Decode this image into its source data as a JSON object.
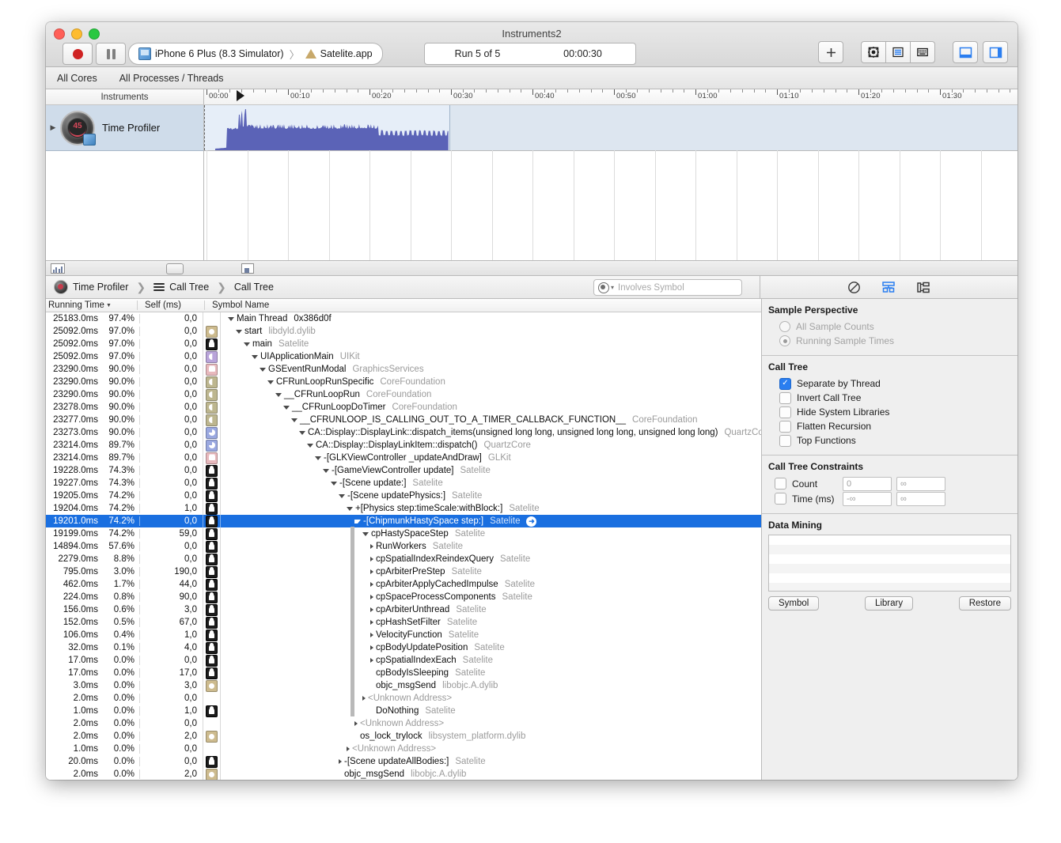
{
  "window": {
    "title": "Instruments2"
  },
  "toolbar": {
    "record_label": "record-button",
    "pause_label": "pause-button",
    "target_device": "iPhone 6 Plus (8.3 Simulator)",
    "target_separator": "〉",
    "target_app": "Satelite.app",
    "run_label": "Run 5 of 5",
    "run_time": "00:00:30",
    "add_button": "+",
    "buttons": [
      "add-instrument",
      "settings",
      "list-view",
      "keyboard-view",
      "library-panel",
      "inspector-panel"
    ]
  },
  "filterbar": {
    "cores": "All Cores",
    "processes": "All Processes / Threads"
  },
  "timeline": {
    "header_label": "Instruments",
    "ticks": [
      "00:00",
      "00:10",
      "00:20",
      "00:30",
      "00:40",
      "00:50",
      "01:00",
      "01:10",
      "01:20",
      "01:30"
    ],
    "instrument_name": "Time Profiler",
    "instrument_icon_number": "45",
    "graph_color": "#5b63b7",
    "selection_color": "#e6eef8"
  },
  "detail_header": {
    "instrument": "Time Profiler",
    "view_mode": "Call Tree",
    "breadcrumb": "Call Tree",
    "search_placeholder": "Involves Symbol"
  },
  "columns": {
    "running_time": "Running Time",
    "self_ms": "Self (ms)",
    "symbol_name": "Symbol Name"
  },
  "rows": [
    {
      "time": "25183.0ms",
      "pct": "97.4%",
      "self": "0,0",
      "icon": "none",
      "depth": 0,
      "tri": "open",
      "name": "Main Thread",
      "lib": "0x386d0f",
      "libstyle": "plain"
    },
    {
      "time": "25092.0ms",
      "pct": "97.0%",
      "self": "0,0",
      "icon": "gear",
      "depth": 1,
      "tri": "open",
      "name": "start",
      "lib": "libdyld.dylib"
    },
    {
      "time": "25092.0ms",
      "pct": "97.0%",
      "self": "0,0",
      "icon": "user",
      "depth": 2,
      "tri": "open",
      "name": "main",
      "lib": "Satelite"
    },
    {
      "time": "25092.0ms",
      "pct": "97.0%",
      "self": "0,0",
      "icon": "purple",
      "depth": 3,
      "tri": "open",
      "name": "UIApplicationMain",
      "lib": "UIKit"
    },
    {
      "time": "23290.0ms",
      "pct": "90.0%",
      "self": "0,0",
      "icon": "pink",
      "depth": 4,
      "tri": "open",
      "name": "GSEventRunModal",
      "lib": "GraphicsServices"
    },
    {
      "time": "23290.0ms",
      "pct": "90.0%",
      "self": "0,0",
      "icon": "olive",
      "depth": 5,
      "tri": "open",
      "name": "CFRunLoopRunSpecific",
      "lib": "CoreFoundation"
    },
    {
      "time": "23290.0ms",
      "pct": "90.0%",
      "self": "0,0",
      "icon": "olive",
      "depth": 6,
      "tri": "open",
      "name": "__CFRunLoopRun",
      "lib": "CoreFoundation"
    },
    {
      "time": "23278.0ms",
      "pct": "90.0%",
      "self": "0,0",
      "icon": "olive",
      "depth": 7,
      "tri": "open",
      "name": "__CFRunLoopDoTimer",
      "lib": "CoreFoundation"
    },
    {
      "time": "23277.0ms",
      "pct": "90.0%",
      "self": "0,0",
      "icon": "olive",
      "depth": 8,
      "tri": "open",
      "name": "__CFRUNLOOP_IS_CALLING_OUT_TO_A_TIMER_CALLBACK_FUNCTION__",
      "lib": "CoreFoundation"
    },
    {
      "time": "23273.0ms",
      "pct": "90.0%",
      "self": "0,0",
      "icon": "blue",
      "depth": 9,
      "tri": "open",
      "name": "CA::Display::DisplayLink::dispatch_items(unsigned long long, unsigned long long, unsigned long long)",
      "lib": "QuartzCore"
    },
    {
      "time": "23214.0ms",
      "pct": "89.7%",
      "self": "0,0",
      "icon": "blue",
      "depth": 10,
      "tri": "open",
      "name": "CA::Display::DisplayLinkItem::dispatch()",
      "lib": "QuartzCore"
    },
    {
      "time": "23214.0ms",
      "pct": "89.7%",
      "self": "0,0",
      "icon": "pink",
      "depth": 11,
      "tri": "open",
      "name": "-[GLKViewController _updateAndDraw]",
      "lib": "GLKit"
    },
    {
      "time": "19228.0ms",
      "pct": "74.3%",
      "self": "0,0",
      "icon": "user",
      "depth": 12,
      "tri": "open",
      "name": "-[GameViewController update]",
      "lib": "Satelite"
    },
    {
      "time": "19227.0ms",
      "pct": "74.3%",
      "self": "0,0",
      "icon": "user",
      "depth": 13,
      "tri": "open",
      "name": "-[Scene update:]",
      "lib": "Satelite"
    },
    {
      "time": "19205.0ms",
      "pct": "74.2%",
      "self": "0,0",
      "icon": "user",
      "depth": 14,
      "tri": "open",
      "name": "-[Scene updatePhysics:]",
      "lib": "Satelite"
    },
    {
      "time": "19204.0ms",
      "pct": "74.2%",
      "self": "1,0",
      "icon": "user",
      "depth": 15,
      "tri": "open",
      "name": "+[Physics step:timeScale:withBlock:]",
      "lib": "Satelite"
    },
    {
      "time": "19201.0ms",
      "pct": "74.2%",
      "self": "0,0",
      "icon": "user",
      "depth": 16,
      "tri": "open",
      "name": "-[ChipmunkHastySpace step:]",
      "lib": "Satelite",
      "selected": true,
      "arrow": true
    },
    {
      "time": "19199.0ms",
      "pct": "74.2%",
      "self": "59,0",
      "icon": "user",
      "depth": 17,
      "tri": "open",
      "name": "cpHastySpaceStep",
      "lib": "Satelite"
    },
    {
      "time": "14894.0ms",
      "pct": "57.6%",
      "self": "0,0",
      "icon": "user",
      "depth": 18,
      "tri": "closed",
      "name": "RunWorkers",
      "lib": "Satelite"
    },
    {
      "time": "2279.0ms",
      "pct": "8.8%",
      "self": "0,0",
      "icon": "user",
      "depth": 18,
      "tri": "closed",
      "name": "cpSpatialIndexReindexQuery",
      "lib": "Satelite"
    },
    {
      "time": "795.0ms",
      "pct": "3.0%",
      "self": "190,0",
      "icon": "user",
      "depth": 18,
      "tri": "closed",
      "name": "cpArbiterPreStep",
      "lib": "Satelite"
    },
    {
      "time": "462.0ms",
      "pct": "1.7%",
      "self": "44,0",
      "icon": "user",
      "depth": 18,
      "tri": "closed",
      "name": "cpArbiterApplyCachedImpulse",
      "lib": "Satelite"
    },
    {
      "time": "224.0ms",
      "pct": "0.8%",
      "self": "90,0",
      "icon": "user",
      "depth": 18,
      "tri": "closed",
      "name": "cpSpaceProcessComponents",
      "lib": "Satelite"
    },
    {
      "time": "156.0ms",
      "pct": "0.6%",
      "self": "3,0",
      "icon": "user",
      "depth": 18,
      "tri": "closed",
      "name": "cpArbiterUnthread",
      "lib": "Satelite"
    },
    {
      "time": "152.0ms",
      "pct": "0.5%",
      "self": "67,0",
      "icon": "user",
      "depth": 18,
      "tri": "closed",
      "name": "cpHashSetFilter",
      "lib": "Satelite"
    },
    {
      "time": "106.0ms",
      "pct": "0.4%",
      "self": "1,0",
      "icon": "user",
      "depth": 18,
      "tri": "closed",
      "name": "VelocityFunction",
      "lib": "Satelite"
    },
    {
      "time": "32.0ms",
      "pct": "0.1%",
      "self": "4,0",
      "icon": "user",
      "depth": 18,
      "tri": "closed",
      "name": "cpBodyUpdatePosition",
      "lib": "Satelite"
    },
    {
      "time": "17.0ms",
      "pct": "0.0%",
      "self": "0,0",
      "icon": "user",
      "depth": 18,
      "tri": "closed",
      "name": "cpSpatialIndexEach",
      "lib": "Satelite"
    },
    {
      "time": "17.0ms",
      "pct": "0.0%",
      "self": "17,0",
      "icon": "user",
      "depth": 18,
      "tri": "none",
      "name": "cpBodyIsSleeping",
      "lib": "Satelite"
    },
    {
      "time": "3.0ms",
      "pct": "0.0%",
      "self": "3,0",
      "icon": "gear",
      "depth": 18,
      "tri": "none",
      "name": "objc_msgSend",
      "lib": "libobjc.A.dylib"
    },
    {
      "time": "2.0ms",
      "pct": "0.0%",
      "self": "0,0",
      "icon": "none",
      "depth": 17,
      "tri": "closed",
      "name": "<Unknown Address>",
      "lib": "",
      "libstyle": "dim"
    },
    {
      "time": "1.0ms",
      "pct": "0.0%",
      "self": "1,0",
      "icon": "user",
      "depth": 18,
      "tri": "none",
      "name": "DoNothing",
      "lib": "Satelite"
    },
    {
      "time": "2.0ms",
      "pct": "0.0%",
      "self": "0,0",
      "icon": "none",
      "depth": 16,
      "tri": "closed",
      "name": "<Unknown Address>",
      "lib": "",
      "libstyle": "dim"
    },
    {
      "time": "2.0ms",
      "pct": "0.0%",
      "self": "2,0",
      "icon": "gear",
      "depth": 16,
      "tri": "none",
      "name": "os_lock_trylock",
      "lib": "libsystem_platform.dylib"
    },
    {
      "time": "1.0ms",
      "pct": "0.0%",
      "self": "0,0",
      "icon": "none",
      "depth": 15,
      "tri": "closed",
      "name": "<Unknown Address>",
      "lib": "",
      "libstyle": "dim"
    },
    {
      "time": "20.0ms",
      "pct": "0.0%",
      "self": "0,0",
      "icon": "user",
      "depth": 14,
      "tri": "closed",
      "name": "-[Scene updateAllBodies:]",
      "lib": "Satelite"
    },
    {
      "time": "2.0ms",
      "pct": "0.0%",
      "self": "2,0",
      "icon": "gear",
      "depth": 14,
      "tri": "none",
      "name": "objc_msgSend",
      "lib": "libobjc.A.dylib"
    }
  ],
  "inspector": {
    "sample_perspective": {
      "title": "Sample Perspective",
      "options": [
        {
          "label": "All Sample Counts",
          "selected": false
        },
        {
          "label": "Running Sample Times",
          "selected": true
        }
      ]
    },
    "call_tree": {
      "title": "Call Tree",
      "options": [
        {
          "label": "Separate by Thread",
          "checked": true
        },
        {
          "label": "Invert Call Tree",
          "checked": false
        },
        {
          "label": "Hide System Libraries",
          "checked": false
        },
        {
          "label": "Flatten Recursion",
          "checked": false
        },
        {
          "label": "Top Functions",
          "checked": false
        }
      ]
    },
    "constraints": {
      "title": "Call Tree Constraints",
      "rows": [
        {
          "label": "Count",
          "checked": false,
          "min": "0",
          "max": "∞"
        },
        {
          "label": "Time (ms)",
          "checked": false,
          "min": "-∞",
          "max": "∞"
        }
      ]
    },
    "data_mining": {
      "title": "Data Mining",
      "buttons": [
        "Symbol",
        "Library",
        "Restore"
      ]
    }
  },
  "colors": {
    "selection_blue": "#1a6fe0",
    "accent_blue": "#2a7ef0",
    "graph_purple": "#5b63b7"
  }
}
